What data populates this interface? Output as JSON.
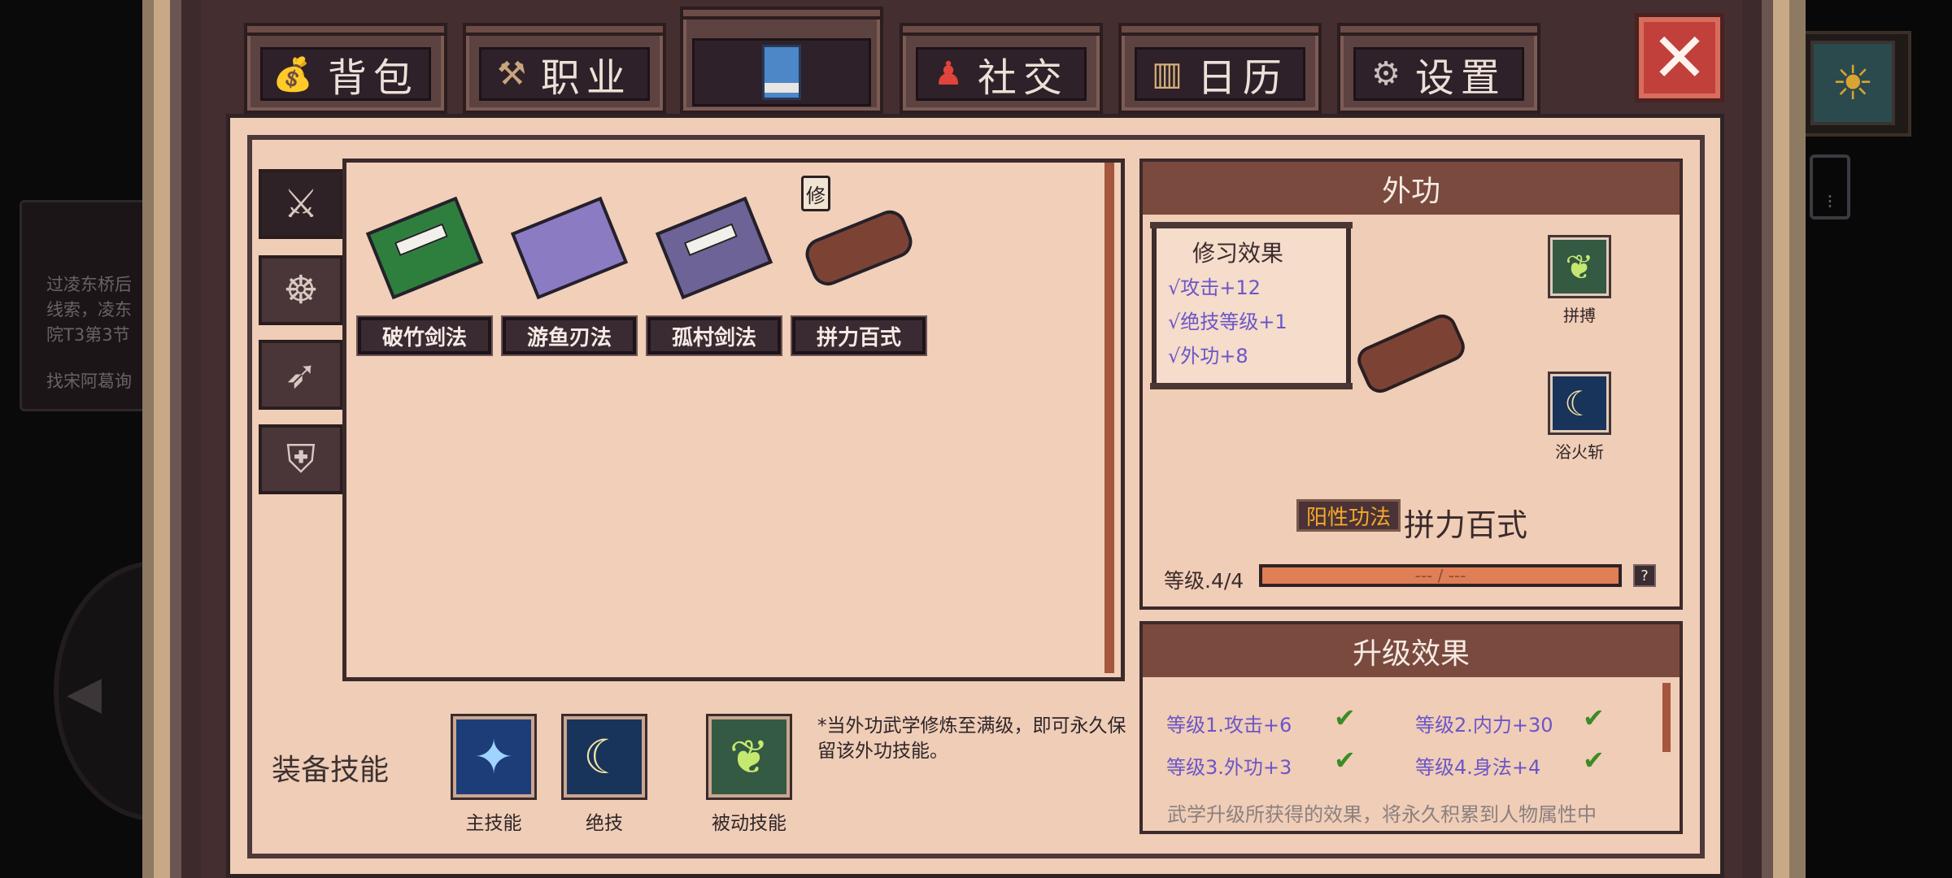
{
  "tabs": {
    "bag": "背包",
    "job": "职业",
    "social": "社交",
    "calendar": "日历",
    "settings": "设置"
  },
  "background": {
    "quest_lines": [
      "过凌东桥后",
      "线索，凌东",
      "院T3第3节"
    ],
    "quest_hint": "找宋阿葛询"
  },
  "books": [
    {
      "name": "破竹剑法"
    },
    {
      "name": "游鱼刃法"
    },
    {
      "name": "孤村剑法"
    },
    {
      "name": "拼力百式"
    }
  ],
  "repair_badge": "修",
  "equip": {
    "title": "装备技能",
    "slots": [
      {
        "label": "主技能",
        "icon": "blue-crystal-icon"
      },
      {
        "label": "绝技",
        "icon": "crescent-moon-icon"
      },
      {
        "label": "被动技能",
        "icon": "green-leaf-icon"
      }
    ],
    "note": "*当外功武学修炼至满级，即可永久保留该外功技能。"
  },
  "detail": {
    "header": "外功",
    "effect_title": "修习效果",
    "effects": [
      "√攻击+12",
      "√绝技等级+1",
      "√外功+8"
    ],
    "side_skills": [
      {
        "label": "拼搏",
        "icon": "green-leaf-icon"
      },
      {
        "label": "浴火斩",
        "icon": "crescent-moon-icon"
      }
    ],
    "type_badge": "阳性功法",
    "name": "拼力百式",
    "level": "等级.4/4",
    "progress_text": "--- / ---",
    "help": "?"
  },
  "upgrade": {
    "header": "升级效果",
    "items": [
      "等级1.攻击+6",
      "等级2.内力+30",
      "等级3.外功+3",
      "等级4.身法+4"
    ],
    "note": "武学升级所获得的效果，将永久积累到人物属性中"
  },
  "colors": {
    "panel_bg": "#efcdb7",
    "header_brown": "#7a4a3f",
    "effect_purple": "#6b56c8",
    "check_green": "#3b8b26",
    "badge_orange": "#f4a82b"
  }
}
